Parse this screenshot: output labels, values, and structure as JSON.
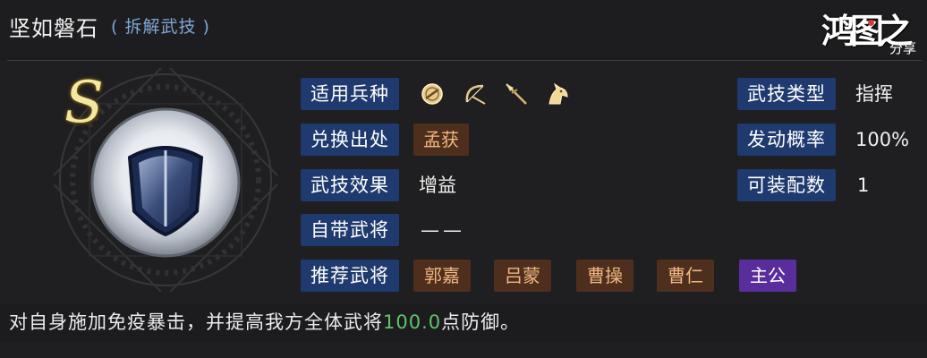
{
  "header": {
    "title": "坚如磐石",
    "subtitle": "( 拆解武技 )",
    "logo_main": "鸿图之下",
    "logo_sub": "分享"
  },
  "skill": {
    "grade": "S",
    "emblem_icon": "shield-icon"
  },
  "info": {
    "troop_label": "适用兵种",
    "troop_icons": [
      "shield-troop-icon",
      "bow-troop-icon",
      "spear-troop-icon",
      "cavalry-troop-icon"
    ],
    "source_label": "兑换出处",
    "source_value": "孟获",
    "effect_label": "武技效果",
    "effect_value": "增益",
    "own_general_label": "自带武将",
    "own_general_value": "——",
    "recommend_label": "推荐武将",
    "recommend_generals": [
      "郭嘉",
      "吕蒙",
      "曹操",
      "曹仁",
      "主公"
    ],
    "type_label": "武技类型",
    "type_value": "指挥",
    "rate_label": "发动概率",
    "rate_value": "100%",
    "slots_label": "可装配数",
    "slots_value": "1"
  },
  "description": {
    "prefix": "对自身施加免疫暴击，并提高我方全体武将",
    "number": "100.0",
    "suffix": "点防御。"
  },
  "colors": {
    "label_bg": "#1e3a6e",
    "tag_brown_bg": "#4e2e1d",
    "tag_brown_text": "#f0b880",
    "tag_purple_bg": "#5a2d9c",
    "highlight_number": "#5fc46a",
    "subtitle": "#7fa6d6"
  }
}
